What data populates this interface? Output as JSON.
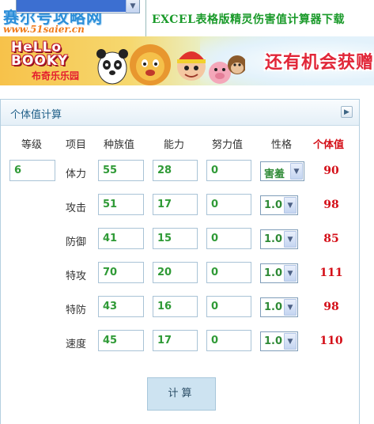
{
  "header": {
    "site_logo_text": "赛尔号攻略网",
    "site_url": "www.51saier.cn",
    "download_link": "EXCEL表格版精灵伤害值计算器下载"
  },
  "banner": {
    "hello_line1": "HeLLo",
    "hello_line2": "BOOKY",
    "hello_cn": "布奇乐乐园",
    "promo_text": "还有机会获赠"
  },
  "panel": {
    "title": "个体值计算",
    "more_icon": "chevron-right-icon"
  },
  "columns": [
    "等级",
    "项目",
    "种族值",
    "能力",
    "努力值",
    "性格",
    "个体值"
  ],
  "level": "6",
  "rows": [
    {
      "item": "体力",
      "base": "55",
      "ability": "28",
      "effort": "0",
      "nature": "害羞",
      "iv": "90"
    },
    {
      "item": "攻击",
      "base": "51",
      "ability": "17",
      "effort": "0",
      "nature": "1.0",
      "iv": "98"
    },
    {
      "item": "防御",
      "base": "41",
      "ability": "15",
      "effort": "0",
      "nature": "1.0",
      "iv": "85"
    },
    {
      "item": "特攻",
      "base": "70",
      "ability": "20",
      "effort": "0",
      "nature": "1.0",
      "iv": "111"
    },
    {
      "item": "特防",
      "base": "43",
      "ability": "16",
      "effort": "0",
      "nature": "1.0",
      "iv": "98"
    },
    {
      "item": "速度",
      "base": "45",
      "ability": "17",
      "effort": "0",
      "nature": "1.0",
      "iv": "110"
    }
  ],
  "calculate_label": "计算",
  "colors": {
    "accent_green": "#2f9a36",
    "result_red": "#d40f18",
    "panel_title": "#1f5f88",
    "button_bg": "#cde3f1"
  }
}
